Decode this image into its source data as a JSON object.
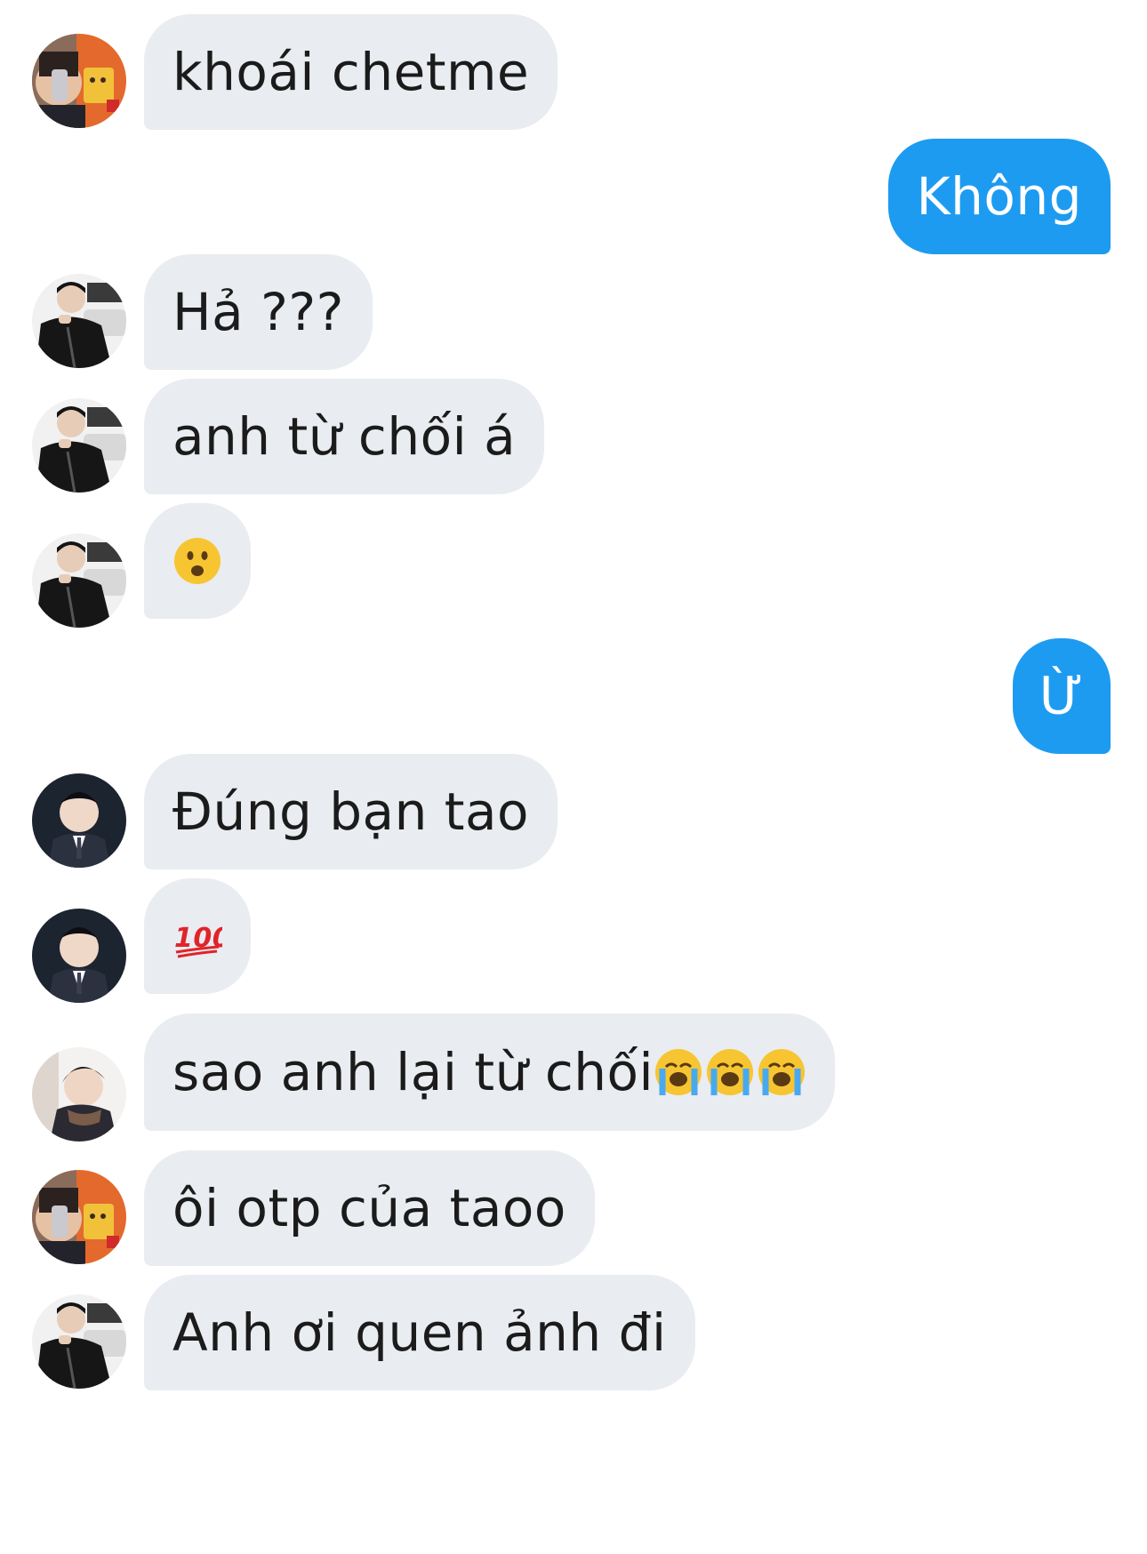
{
  "chat": {
    "messages": [
      {
        "direction": "in",
        "avatar": "avatar-selfie-orange",
        "text": "khoái chetme"
      },
      {
        "direction": "out",
        "text": "Không"
      },
      {
        "direction": "in",
        "avatar": "avatar-jacket-car",
        "text": "Hả ???"
      },
      {
        "direction": "in",
        "avatar": "avatar-jacket-car",
        "text": "anh từ chối á"
      },
      {
        "direction": "in",
        "avatar": "avatar-jacket-car",
        "emoji": "frowning-face-open-mouth"
      },
      {
        "direction": "out",
        "text": "Ừ"
      },
      {
        "direction": "in",
        "avatar": "avatar-suit-dark",
        "text": "Đúng bạn tao"
      },
      {
        "direction": "in",
        "avatar": "avatar-suit-dark",
        "emoji": "hundred-points"
      },
      {
        "direction": "in",
        "avatar": "avatar-scarf",
        "text": "sao anh lại từ chối",
        "trailing_emoji": [
          "loudly-crying-face",
          "loudly-crying-face",
          "loudly-crying-face"
        ]
      },
      {
        "direction": "in",
        "avatar": "avatar-selfie-orange",
        "text": "ôi otp của taoo"
      },
      {
        "direction": "in",
        "avatar": "avatar-jacket-car",
        "text": "Anh ơi quen ảnh đi"
      }
    ]
  },
  "colors": {
    "incoming_bubble": "#e9ecf0",
    "outgoing_bubble": "#1d9bf0",
    "incoming_text": "#1b1b1b",
    "outgoing_text": "#ffffff"
  }
}
